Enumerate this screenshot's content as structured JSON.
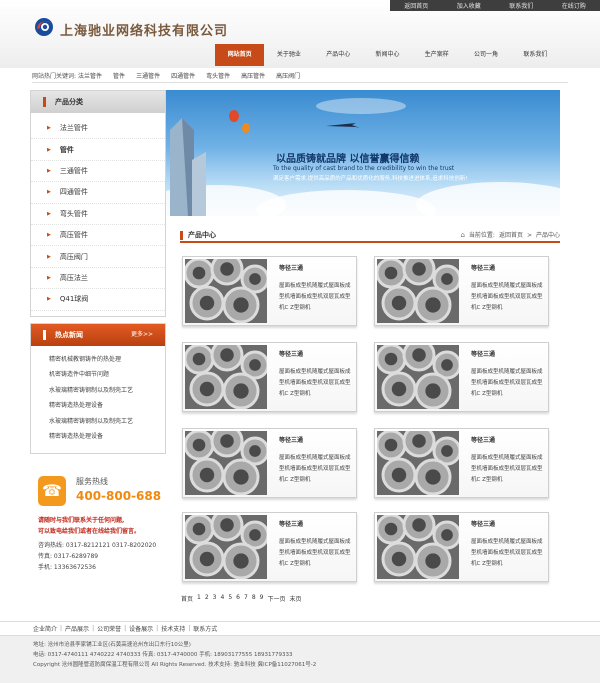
{
  "top_util": [
    "返回首页",
    "加入收藏",
    "联系我们",
    "在线订购"
  ],
  "logo": {
    "text": "上海驰业网络科技有限公司"
  },
  "nav": [
    "网站首页",
    "关于驰业",
    "产品中心",
    "新闻中心",
    "生产案样",
    "公司一角",
    "联系我们"
  ],
  "hotkeys": {
    "label": "网站热门关键词:",
    "items": [
      "法兰管件",
      "管件",
      "三通管件",
      "四通管件",
      "弯头管件",
      "高压管件",
      "高压阀门"
    ]
  },
  "categories": {
    "title": "产品分类",
    "items": [
      "法兰管件",
      "管件",
      "三通管件",
      "四通管件",
      "弯头管件",
      "高压管件",
      "高压阀门",
      "高压法兰",
      "Q41球阀"
    ]
  },
  "news": {
    "title": "热点新闻",
    "more": "更多>>",
    "items": [
      "精密机械教钢铸件的热处理",
      "机密铸造件中细节问题",
      "水玻璃精密铸钢制以及制壳工艺",
      "精密铸造热处理设备",
      "水玻璃精密铸钢制以及制壳工艺",
      "精密铸造热处理设备"
    ]
  },
  "hotline": {
    "label": "服务热线",
    "number": "400-800-688"
  },
  "contact": {
    "warn1": "请随时与我们联系关于任何问题,",
    "warn2": "可以致电给我们或者在线给我们留言。",
    "line1": "咨询热线: 0317-8212121    0317-8202020",
    "line2": "传真: 0317-6289789",
    "line3": "手机: 13363672536"
  },
  "banner": {
    "slogan": "以品质铸就品牌 以信誉赢得信赖",
    "slogan_en": "To the quality of cast brand to the credibility to win the trust",
    "slogan_sub": "满足客户需求,提供高品质的产品和优质化的服务,科技推进进体系,追求科技创新!"
  },
  "product_center": {
    "title": "产品中心",
    "breadcrumb": [
      "当前位置:",
      "返回首页",
      ">",
      "产品中心"
    ]
  },
  "products": [
    {
      "name": "等径三通",
      "desc": "屋面板成型机随履式屋面板成型机墙面板成型机双层瓦成型机C Z型钢机"
    },
    {
      "name": "等径三通",
      "desc": "屋面板成型机随履式屋面板成型机墙面板成型机双层瓦成型机C Z型钢机"
    },
    {
      "name": "等径三通",
      "desc": "屋面板成型机随履式屋面板成型机墙面板成型机双层瓦成型机C Z型钢机"
    },
    {
      "name": "等径三通",
      "desc": "屋面板成型机随履式屋面板成型机墙面板成型机双层瓦成型机C Z型钢机"
    },
    {
      "name": "等径三通",
      "desc": "屋面板成型机随履式屋面板成型机墙面板成型机双层瓦成型机C Z型钢机"
    },
    {
      "name": "等径三通",
      "desc": "屋面板成型机随履式屋面板成型机墙面板成型机双层瓦成型机C Z型钢机"
    },
    {
      "name": "等径三通",
      "desc": "屋面板成型机随履式屋面板成型机墙面板成型机双层瓦成型机C Z型钢机"
    },
    {
      "name": "等径三通",
      "desc": "屋面板成型机随履式屋面板成型机墙面板成型机双层瓦成型机C Z型钢机"
    }
  ],
  "pager": [
    "首页",
    "1",
    "2",
    "3",
    "4",
    "5",
    "6",
    "7",
    "8",
    "9",
    "下一页",
    "末页"
  ],
  "footer_links": [
    "企业简介",
    "产品展示",
    "公司荣誉",
    "设备展示",
    "技术支持",
    "联系方式"
  ],
  "footer": {
    "line1": "地址: 沧州市沧县李家铺工业区(石黄高速沧州东出口东行10公里)",
    "line2": "电话: 0317-4740111 4740222 4740333   传真: 0317-4740000   手机: 18903177555 18931779333",
    "line3": "Copyright 沧州圆隆管道防腐保温工程有限公司 All Rights Reserved. 技术支持: 驰业科技        冀ICP备11027061号-2"
  },
  "colors": {
    "accent": "#c74b19",
    "hotline": "#f08a0f",
    "warn": "#c0271b"
  }
}
